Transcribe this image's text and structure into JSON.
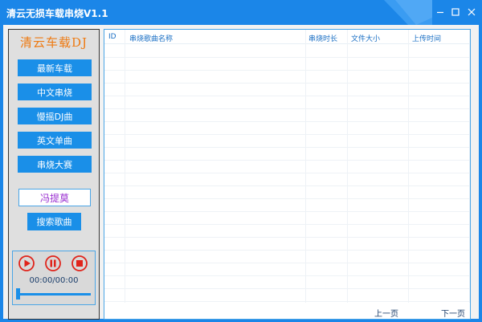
{
  "titlebar": {
    "title": "清云无损车载串烧V1.1"
  },
  "sidebar": {
    "brand": "清云车载DJ",
    "nav": [
      {
        "label": "最新车载"
      },
      {
        "label": "中文串烧"
      },
      {
        "label": "慢摇DJ曲"
      },
      {
        "label": "英文单曲"
      },
      {
        "label": "串烧大赛"
      }
    ],
    "search_value": "冯提莫",
    "search_button": "搜索歌曲"
  },
  "player": {
    "time": "00:00/00:00",
    "progress": 0
  },
  "table": {
    "columns": [
      "ID",
      "串烧歌曲名称",
      "串烧时长",
      "文件大小",
      "上传时间"
    ],
    "rows": []
  },
  "pager": {
    "prev": "上一页",
    "next": "下一页"
  },
  "colors": {
    "accent": "#1b86e8",
    "brand": "#ee7a12",
    "player_red": "#e0241b"
  }
}
